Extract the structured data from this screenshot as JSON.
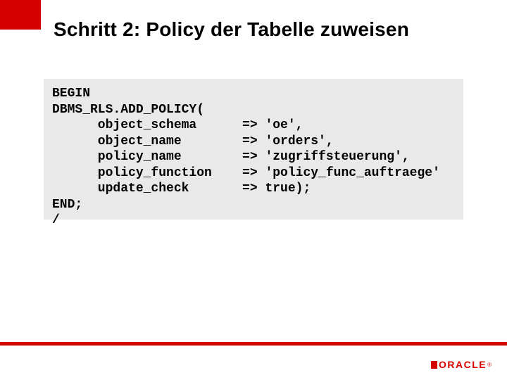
{
  "title": "Schritt 2:  Policy der Tabelle zuweisen",
  "code": "BEGIN\nDBMS_RLS.ADD_POLICY(\n      object_schema      => 'oe',\n      object_name        => 'orders',\n      policy_name        => 'zugriffsteuerung',\n      policy_function    => 'policy_func_auftraege'\n      update_check       => true);\nEND;\n/",
  "logo": {
    "word": "ORACLE",
    "reg": "®"
  }
}
